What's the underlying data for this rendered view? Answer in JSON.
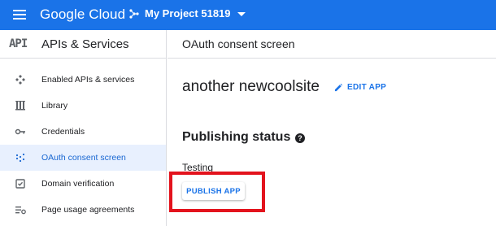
{
  "topbar": {
    "brand": "Google Cloud",
    "project_name": "My Project 51819",
    "background_color": "#1a73e8"
  },
  "sidebar": {
    "badge": "API",
    "title": "APIs & Services",
    "items": [
      {
        "label": "Enabled APIs & services",
        "icon": "hub-icon",
        "active": false
      },
      {
        "label": "Library",
        "icon": "library-icon",
        "active": false
      },
      {
        "label": "Credentials",
        "icon": "key-icon",
        "active": false
      },
      {
        "label": "OAuth consent screen",
        "icon": "consent-icon",
        "active": true
      },
      {
        "label": "Domain verification",
        "icon": "checkbox-icon",
        "active": false
      },
      {
        "label": "Page usage agreements",
        "icon": "settings-list-icon",
        "active": false
      }
    ]
  },
  "main": {
    "page_title": "OAuth consent screen",
    "app_name": "another newcoolsite",
    "edit_label": "EDIT APP",
    "publishing_heading": "Publishing status",
    "help_glyph": "?",
    "status_text": "Testing",
    "publish_label": "PUBLISH APP",
    "highlight_color": "#e3131d"
  }
}
